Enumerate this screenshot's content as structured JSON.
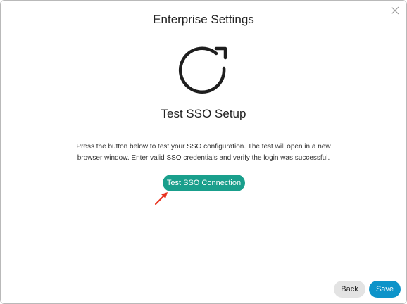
{
  "dialog": {
    "title": "Enterprise Settings",
    "close_icon": "close-icon"
  },
  "content": {
    "icon": "refresh-icon",
    "heading": "Test SSO Setup",
    "description": "Press the button below to test your SSO configuration. The test will open in a new browser window. Enter valid SSO credentials and verify the login was successful.",
    "test_button_label": "Test SSO Connection",
    "annotation_icon": "red-arrow-icon"
  },
  "footer": {
    "back_label": "Back",
    "save_label": "Save"
  },
  "colors": {
    "test_button": "#199f8c",
    "save_button": "#0d93c9",
    "back_button": "#e3e3e3",
    "arrow": "#e8321e"
  }
}
